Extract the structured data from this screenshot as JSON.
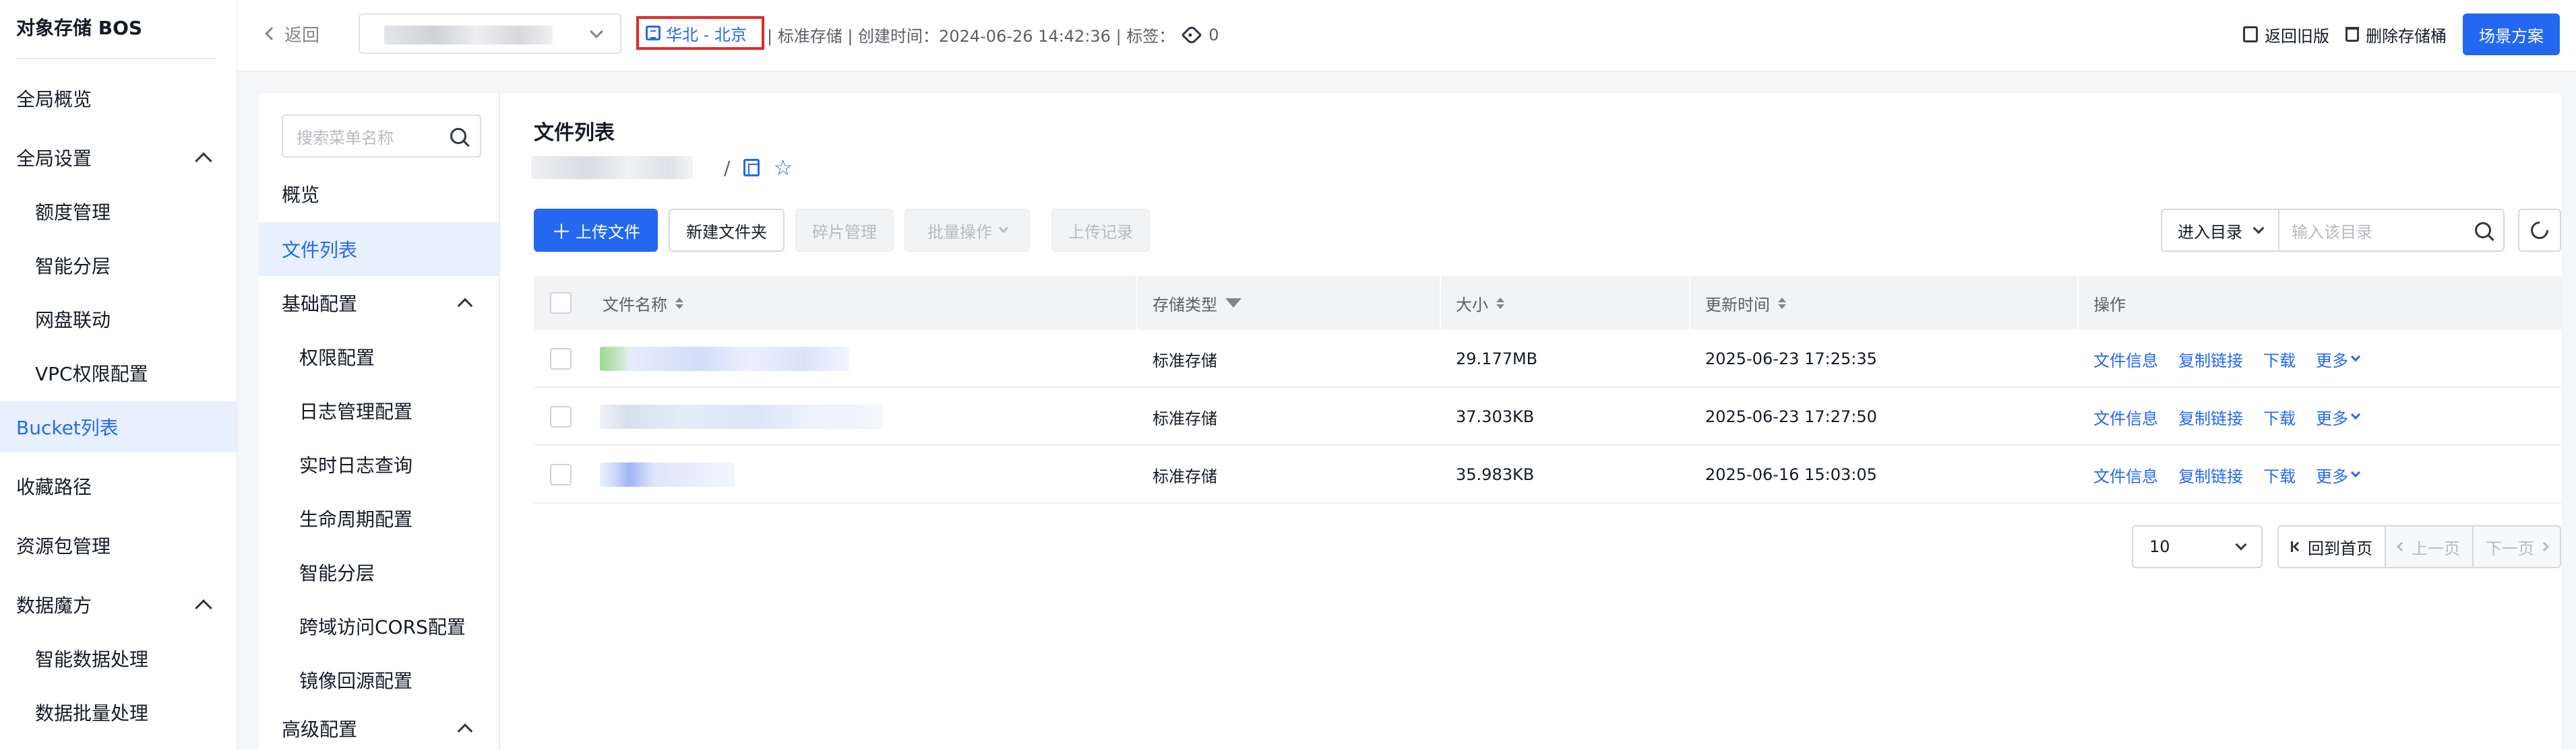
{
  "app_title": "对象存储 BOS",
  "sidebar": {
    "items": [
      {
        "label": "全局概览"
      },
      {
        "label": "全局设置"
      },
      {
        "label": "额度管理"
      },
      {
        "label": "智能分层"
      },
      {
        "label": "网盘联动"
      },
      {
        "label": "VPC权限配置"
      },
      {
        "label": "Bucket列表"
      },
      {
        "label": "收藏路径"
      },
      {
        "label": "资源包管理"
      },
      {
        "label": "数据魔方"
      },
      {
        "label": "智能数据处理"
      },
      {
        "label": "数据批量处理"
      }
    ]
  },
  "header": {
    "back_label": "返回",
    "region": "华北 - 北京",
    "meta": "| 标准存储 | 创建时间：2024-06-26 14:42:36 | 标签：",
    "tag_count": "0",
    "old_version_label": "返回旧版",
    "delete_bucket_label": "删除存储桶",
    "scenario_label": "场景方案"
  },
  "submenu": {
    "search_placeholder": "搜索菜单名称",
    "items": [
      {
        "label": "概览"
      },
      {
        "label": "文件列表"
      },
      {
        "label": "基础配置"
      },
      {
        "label": "权限配置"
      },
      {
        "label": "日志管理配置"
      },
      {
        "label": "实时日志查询"
      },
      {
        "label": "生命周期配置"
      },
      {
        "label": "智能分层"
      },
      {
        "label": "跨域访问CORS配置"
      },
      {
        "label": "镜像回源配置"
      },
      {
        "label": "高级配置"
      }
    ]
  },
  "filelist": {
    "title": "文件列表",
    "path_sep": "/",
    "toolbar": {
      "upload": "上传文件",
      "new_folder": "新建文件夹",
      "fragments": "碎片管理",
      "batch": "批量操作",
      "upload_log": "上传记录",
      "goto_label": "进入目录",
      "goto_placeholder": "输入该目录"
    },
    "columns": {
      "name": "文件名称",
      "storage_type": "存储类型",
      "size": "大小",
      "updated": "更新时间",
      "actions": "操作"
    },
    "rows": [
      {
        "storage_type": "标准存储",
        "size": "29.177MB",
        "updated": "2025-06-23 17:25:35"
      },
      {
        "storage_type": "标准存储",
        "size": "37.303KB",
        "updated": "2025-06-23 17:27:50"
      },
      {
        "storage_type": "标准存储",
        "size": "35.983KB",
        "updated": "2025-06-16 15:03:05"
      }
    ],
    "row_actions": {
      "info": "文件信息",
      "copy_link": "复制链接",
      "download": "下载",
      "more": "更多"
    },
    "pagination": {
      "page_size": "10",
      "first": "回到首页",
      "prev": "上一页",
      "next": "下一页"
    }
  },
  "colors": {
    "accent": "#2468f2",
    "highlight_box": "#e02a2a"
  }
}
